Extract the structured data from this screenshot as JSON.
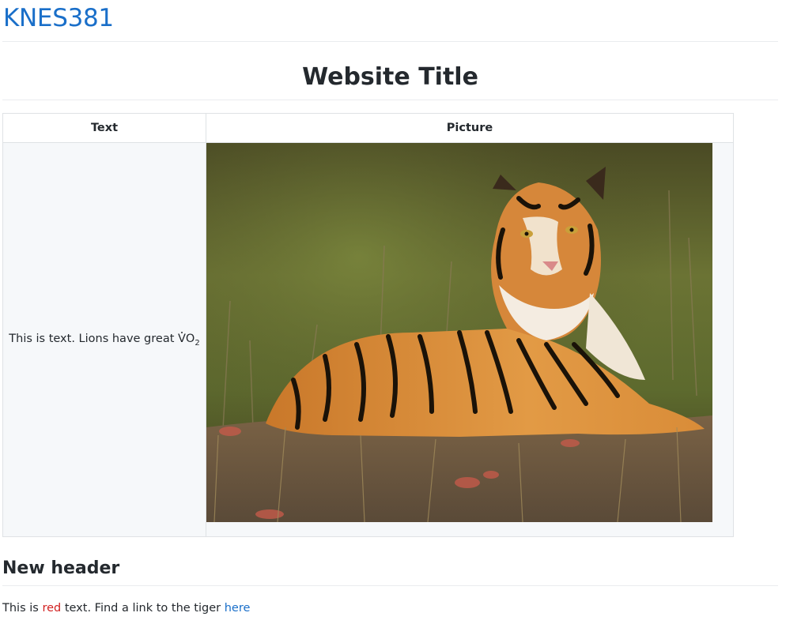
{
  "site": {
    "title": "KNES381"
  },
  "page": {
    "heading": "Website Title"
  },
  "table": {
    "headers": [
      "Text",
      "Picture"
    ],
    "rows": [
      {
        "text_prefix": "This is text. Lions have great ",
        "text_v": "V",
        "text_o": "O",
        "text_sub": "2",
        "picture_subject": "tiger-photo"
      }
    ]
  },
  "section": {
    "header": "New header",
    "paragraph": {
      "before_red": "This is ",
      "red_word": "red",
      "after_red": " text. Find a link to the tiger ",
      "link_text": "here"
    }
  },
  "colors": {
    "link": "#1a6fc9",
    "red_text": "#d22121",
    "heading": "#24292e",
    "cell_background": "#f6f8fa"
  }
}
